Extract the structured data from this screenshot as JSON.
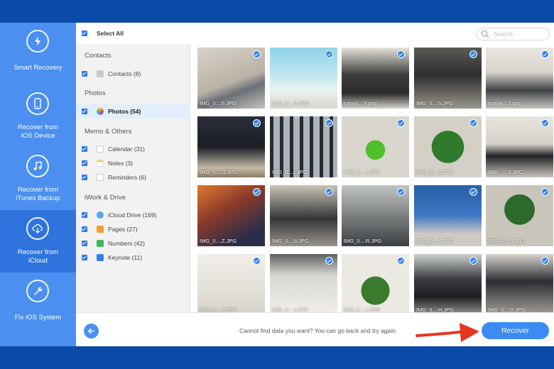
{
  "sidebar": {
    "items": [
      {
        "line1": "Smart Recovery",
        "line2": "",
        "icon": "smart-recovery-icon",
        "active": false
      },
      {
        "line1": "Recover from",
        "line2": "iOS Device",
        "icon": "phone-icon",
        "active": false
      },
      {
        "line1": "Recover from",
        "line2": "iTunes Backup",
        "icon": "music-note-icon",
        "active": false
      },
      {
        "line1": "Recover from",
        "line2": "iCloud",
        "icon": "cloud-download-icon",
        "active": true
      },
      {
        "line1": "Fix iOS System",
        "line2": "",
        "icon": "wrench-icon",
        "active": false
      }
    ]
  },
  "categories": {
    "select_all": "Select All",
    "sections": [
      {
        "header": "Contacts",
        "items": [
          {
            "label": "Contacts (8)",
            "icon": "contacts-icon"
          }
        ]
      },
      {
        "header": "Photos",
        "items": [
          {
            "label": "Photos (54)",
            "icon": "photos-icon"
          }
        ]
      },
      {
        "header": "Memo & Others",
        "items": [
          {
            "label": "Calendar (31)",
            "icon": "calendar-icon"
          },
          {
            "label": "Notes (3)",
            "icon": "notes-icon"
          },
          {
            "label": "Reminders (6)",
            "icon": "reminders-icon"
          }
        ]
      },
      {
        "header": "iWork & Drive",
        "items": [
          {
            "label": "iCloud Drive (169)",
            "icon": "icloud-drive-icon"
          },
          {
            "label": "Pages (27)",
            "icon": "pages-icon"
          },
          {
            "label": "Numbers (42)",
            "icon": "numbers-icon"
          },
          {
            "label": "Keynote (11)",
            "icon": "keynote-icon"
          }
        ]
      }
    ]
  },
  "search": {
    "placeholder": "Search"
  },
  "photos": [
    {
      "name": "IMG_0....6.JPG"
    },
    {
      "name": "IMG_0....h.JPG"
    },
    {
      "name": "canva....Y.png"
    },
    {
      "name": "IMG_0....h.JPG"
    },
    {
      "name": "image....1.jpg"
    },
    {
      "name": "IMG_0....Q.JPG"
    },
    {
      "name": "IMG_0....r.JPG"
    },
    {
      "name": "IMG_0....c.JPG"
    },
    {
      "name": "IMG_0....Z.JPG"
    },
    {
      "name": "IMG_.....2.JPG"
    },
    {
      "name": "IMG_0....Z.JPG"
    },
    {
      "name": "IMG_0....8.JPG"
    },
    {
      "name": "IMG_0....R.JPG"
    },
    {
      "name": "IMG_0....K.JPG"
    },
    {
      "name": "IMG_0....q.JPG"
    },
    {
      "name": "IMG_0....9.JPG"
    },
    {
      "name": "IMG_0....v.JPG"
    },
    {
      "name": "IMG_0....x.JPG"
    },
    {
      "name": "IMG_0....H.JPG"
    },
    {
      "name": "IMG_0....D.JPG"
    }
  ],
  "footer": {
    "hint": "Cannot find data you want? You can go back and try again.",
    "recover_label": "Recover"
  },
  "colors": {
    "accent": "#3b8bf3",
    "sidebar": "#4b8ff0",
    "arrow": "#e8351f"
  }
}
